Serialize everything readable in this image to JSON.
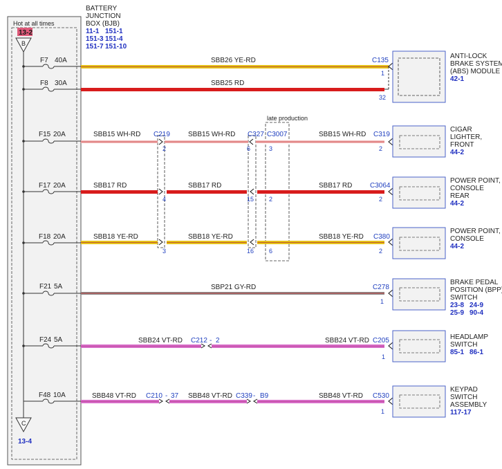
{
  "bjb": {
    "title_lines": [
      "BATTERY",
      "JUNCTION",
      "BOX (BJB)"
    ],
    "refs": [
      "11-1",
      "151-1",
      "151-3",
      "151-4",
      "151-7",
      "151-10"
    ],
    "hot_label": "Hot at all times",
    "top_ref": "13-2",
    "top_node": "B",
    "bottom_node": "C",
    "bottom_ref": "13-4"
  },
  "late_production": "late production",
  "colors": {
    "YE-RD": "#e6c21a",
    "RD": "#d81c1c",
    "WH-RD": "#f2b9b9",
    "GY-RD": "#b0575a",
    "VT-RD": "#d76cc8",
    "accent_blue": "#1f3fbf",
    "ref_pink": "#e05a7a"
  },
  "circuits": [
    {
      "fuse": "F7",
      "amps": "40A",
      "color": "YE-RD",
      "segments": [
        {
          "label": "SBB26  YE-RD"
        }
      ],
      "end_connector": "C135",
      "end_pins": [
        "1",
        "32"
      ]
    },
    {
      "fuse": "F8",
      "amps": "30A",
      "color": "RD",
      "segments": [
        {
          "label": "SBB25  RD"
        }
      ],
      "end_connector": "",
      "end_pins": []
    },
    {
      "fuse": "F15",
      "amps": "20A",
      "color": "WH-RD",
      "segments": [
        {
          "label": "SBB15  WH-RD",
          "connector": "C219",
          "pin": "2"
        },
        {
          "label": "SBB15  WH-RD",
          "connector": "C327",
          "pin": "6"
        },
        {
          "label": "SBB15  WH-RD",
          "connector": "C3007",
          "pin": "3"
        }
      ],
      "end_connector": "C319",
      "end_pins": [
        "2"
      ]
    },
    {
      "fuse": "F17",
      "amps": "20A",
      "color": "RD",
      "segments": [
        {
          "label": "SBB17  RD",
          "pin": "4"
        },
        {
          "label": "SBB17  RD",
          "pin": "15"
        },
        {
          "label": "SBB17  RD",
          "pin": "2"
        }
      ],
      "end_connector": "C3064",
      "end_pins": [
        "2"
      ]
    },
    {
      "fuse": "F18",
      "amps": "20A",
      "color": "YE-RD",
      "segments": [
        {
          "label": "SBB18  YE-RD",
          "pin": "3"
        },
        {
          "label": "SBB18  YE-RD",
          "pin": "16"
        },
        {
          "label": "SBB18  YE-RD",
          "pin": "6"
        }
      ],
      "end_connector": "C380",
      "end_pins": [
        "2"
      ]
    },
    {
      "fuse": "F21",
      "amps": "5A",
      "color": "GY-RD",
      "segments": [
        {
          "label": "SBP21  GY-RD"
        }
      ],
      "end_connector": "C278",
      "end_pins": [
        "1"
      ]
    },
    {
      "fuse": "F24",
      "amps": "5A",
      "color": "VT-RD",
      "segments": [
        {
          "label": "SBB24  VT-RD",
          "connector": "C212",
          "pin": "2"
        },
        {
          "label": "SBB24  VT-RD"
        }
      ],
      "end_connector": "C205",
      "end_pins": [
        "1"
      ]
    },
    {
      "fuse": "F48",
      "amps": "10A",
      "color": "VT-RD",
      "segments": [
        {
          "label": "SBB48  VT-RD",
          "connector": "C210",
          "pin": "37"
        },
        {
          "label": "SBB48  VT-RD",
          "connector": "C339",
          "pin": "B9"
        },
        {
          "label": "SBB48  VT-RD"
        }
      ],
      "end_connector": "C530",
      "end_pins": [
        "1"
      ]
    }
  ],
  "components": [
    {
      "lines": [
        "ANTI-LOCK",
        "BRAKE SYSTEM",
        "(ABS) MODULE"
      ],
      "refs": [
        "42-1"
      ]
    },
    {
      "lines": [
        "CIGAR",
        "LIGHTER,",
        "FRONT"
      ],
      "refs": [
        "44-2"
      ]
    },
    {
      "lines": [
        "POWER POINT,",
        "CONSOLE",
        "REAR"
      ],
      "refs": [
        "44-2"
      ]
    },
    {
      "lines": [
        "POWER POINT,",
        "CONSOLE"
      ],
      "refs": [
        "44-2"
      ]
    },
    {
      "lines": [
        "BRAKE PEDAL",
        "POSITION (BPP)",
        "SWITCH"
      ],
      "refs": [
        "23-8",
        "24-9",
        "25-9",
        "90-4"
      ]
    },
    {
      "lines": [
        "HEADLAMP",
        "SWITCH"
      ],
      "refs": [
        "85-1",
        "86-1"
      ]
    },
    {
      "lines": [
        "KEYPAD",
        "SWITCH",
        "ASSEMBLY"
      ],
      "refs": [
        "117-17"
      ]
    }
  ]
}
